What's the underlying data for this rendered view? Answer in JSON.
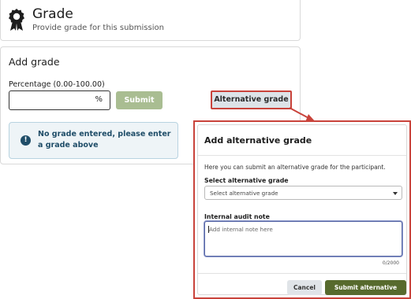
{
  "grade_header": {
    "title": "Grade",
    "subtitle": "Provide grade for this submission",
    "icon": "award-ribbon-icon"
  },
  "add_grade": {
    "title": "Add grade",
    "percentage_label": "Percentage (0.00-100.00)",
    "percentage_value": "",
    "percentage_suffix": "%",
    "submit_label": "Submit",
    "alternative_grade_label": "Alternative grade"
  },
  "alert": {
    "icon": "exclamation-circle-icon",
    "text": "No grade entered, please enter a grade above"
  },
  "modal": {
    "title": "Add alternative grade",
    "description": "Here you can submit an alternative grade for the participant.",
    "select_label": "Select alternative grade",
    "select_placeholder": "Select alternative grade",
    "note_label": "Internal audit note",
    "note_placeholder": "Add internal note here",
    "note_counter": "0/2000",
    "cancel_label": "Cancel",
    "submit_label": "Submit alternative grade"
  },
  "colors": {
    "highlight": "#c9433b",
    "submit_disabled": "#a9bd92",
    "submit_primary": "#576a2d",
    "alert_text": "#1f4d68",
    "alert_bg": "#eef4f7"
  }
}
